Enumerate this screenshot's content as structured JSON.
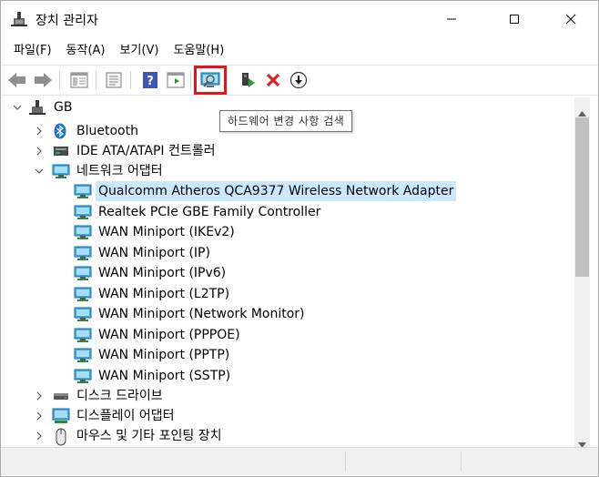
{
  "window": {
    "title": "장치 관리자",
    "icon": "device-manager-icon"
  },
  "menubar": {
    "items": [
      "파일(F)",
      "동작(A)",
      "보기(V)",
      "도움말(H)"
    ]
  },
  "toolbar": {
    "buttons": [
      "back-icon",
      "forward-icon",
      "properties-pane-icon",
      "properties-icon",
      "help-icon",
      "show-hide-icon",
      "scan-hardware-icon",
      "update-driver-icon",
      "uninstall-icon",
      "download-icon"
    ],
    "highlighted": "scan-hardware-icon",
    "highlight_color": "#e3141c"
  },
  "tooltip": {
    "text": "하드웨어 변경 사항 검색"
  },
  "tree": {
    "root": "GB",
    "categories": [
      {
        "label": "Bluetooth",
        "icon": "bluetooth-icon",
        "expanded": false
      },
      {
        "label": "IDE ATA/ATAPI 컨트롤러",
        "icon": "ide-controller-icon",
        "expanded": false
      },
      {
        "label": "네트워크 어댑터",
        "icon": "network-adapter-icon",
        "expanded": true,
        "children": [
          "Qualcomm Atheros QCA9377 Wireless Network Adapter",
          "Realtek PCIe GBE Family Controller",
          "WAN Miniport (IKEv2)",
          "WAN Miniport (IP)",
          "WAN Miniport (IPv6)",
          "WAN Miniport (L2TP)",
          "WAN Miniport (Network Monitor)",
          "WAN Miniport (PPPOE)",
          "WAN Miniport (PPTP)",
          "WAN Miniport (SSTP)"
        ]
      },
      {
        "label": "디스크 드라이브",
        "icon": "disk-drive-icon",
        "expanded": false
      },
      {
        "label": "디스플레이 어댑터",
        "icon": "display-adapter-icon",
        "expanded": false
      },
      {
        "label": "마우스 및 기타 포인팅 장치",
        "icon": "mouse-icon",
        "expanded": false
      }
    ],
    "selected": "Qualcomm Atheros QCA9377 Wireless Network Adapter",
    "selection_color": "#cce8ff"
  }
}
